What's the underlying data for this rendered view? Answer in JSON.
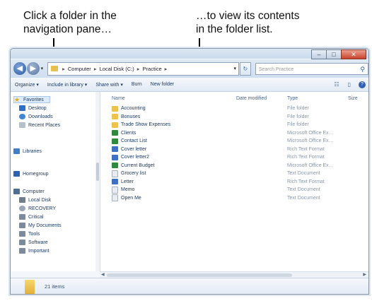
{
  "callouts": {
    "left_line1": "Click a folder in the",
    "left_line2": "navigation pane…",
    "right_line1": "…to view its contents",
    "right_line2": "in the folder list."
  },
  "window": {
    "controls": [
      "–",
      "□",
      "✕"
    ]
  },
  "address": {
    "back_icon": "back-arrow-icon",
    "forward_icon": "forward-arrow-icon",
    "crumbs": [
      "Computer",
      "Local Disk (C:)",
      "Practice"
    ],
    "search_placeholder": "Search Practice"
  },
  "commandbar": {
    "organize": "Organize ▾",
    "include": "Include in library ▾",
    "share": "Share with ▾",
    "burn": "Burn",
    "new_folder": "New folder"
  },
  "navpane": {
    "favorites": "Favorites",
    "desktop": "Desktop",
    "downloads": "Downloads",
    "recent": "Recent Places",
    "libraries": "Libraries",
    "homegroup": "Homegroup",
    "computer": "Computer",
    "local_disk": "Local Disk",
    "recover": "RECOVERY",
    "critical": "Critical",
    "my_documents": "My Documents",
    "tools": "Tools",
    "software": "Software",
    "important": "Important"
  },
  "filelist": {
    "headers": {
      "name": "Name",
      "date": "Date modified",
      "type": "Type",
      "size": "Size"
    },
    "files": [
      {
        "name": "Accounting",
        "date": "",
        "type": "File folder",
        "icon": "folder"
      },
      {
        "name": "Bonuses",
        "date": "",
        "type": "File folder",
        "icon": "folder"
      },
      {
        "name": "Trade Show Expenses",
        "date": "",
        "type": "File folder",
        "icon": "folder"
      },
      {
        "name": "Clients",
        "date": "",
        "type": "Microsoft Office Ex…",
        "icon": "excel"
      },
      {
        "name": "Contact List",
        "date": "",
        "type": "Microsoft Office Ex…",
        "icon": "excel"
      },
      {
        "name": "Cover letter",
        "date": "",
        "type": "Rich Text Format",
        "icon": "word"
      },
      {
        "name": "Cover letter2",
        "date": "",
        "type": "Rich Text Format",
        "icon": "word"
      },
      {
        "name": "Current Budget",
        "date": "",
        "type": "Microsoft Office Ex…",
        "icon": "excel"
      },
      {
        "name": "Grocery list",
        "date": "",
        "type": "Text Document",
        "icon": "txt"
      },
      {
        "name": "Letter",
        "date": "",
        "type": "Rich Text Format",
        "icon": "word"
      },
      {
        "name": "Memo",
        "date": "",
        "type": "Text Document",
        "icon": "txt"
      },
      {
        "name": "Open Me",
        "date": "",
        "type": "Text Document",
        "icon": "txt"
      }
    ]
  },
  "details": {
    "item_count": "21 items"
  }
}
